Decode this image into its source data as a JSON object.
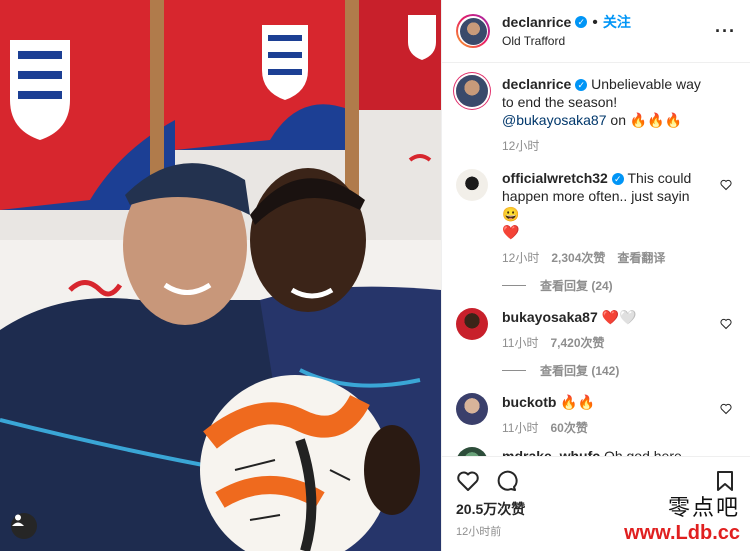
{
  "header": {
    "username": "declanrice",
    "verified": "✓",
    "separator": "•",
    "follow_label": "关注",
    "location": "Old Trafford",
    "more": "···"
  },
  "caption": {
    "username": "declanrice",
    "verified": "✓",
    "text_a": "Unbelievable way to end the season!",
    "mention": "@bukayosaka87",
    "text_b": "on",
    "emoji": "🔥🔥🔥",
    "time": "12小时"
  },
  "comments": [
    {
      "username": "officialwretch32",
      "verified": "✓",
      "text": "This could happen more often.. just sayin 😀",
      "emoji2": "❤️",
      "time": "12小时",
      "likes": "2,304次赞",
      "translate": "查看翻译"
    },
    {
      "username": "bukayosaka87",
      "text": "❤️🤍",
      "time": "11小时",
      "likes": "7,420次赞"
    },
    {
      "username": "buckotb",
      "text": "🔥🔥",
      "time": "11小时",
      "likes": "60次赞"
    },
    {
      "username": "mdrake_whufc",
      "text": "Oh god here come"
    }
  ],
  "view_replies": [
    "查看回复 (24)",
    "查看回复 (142)"
  ],
  "actions": {
    "likes_count": "20.5万次赞",
    "posted_ago": "12小时前"
  },
  "watermark": {
    "line1": "零点吧",
    "line2": "www.Ldb.cc"
  },
  "colors": {
    "accent": "#0095f6",
    "england_red": "#d7262e",
    "england_blue": "#1c3f94"
  }
}
